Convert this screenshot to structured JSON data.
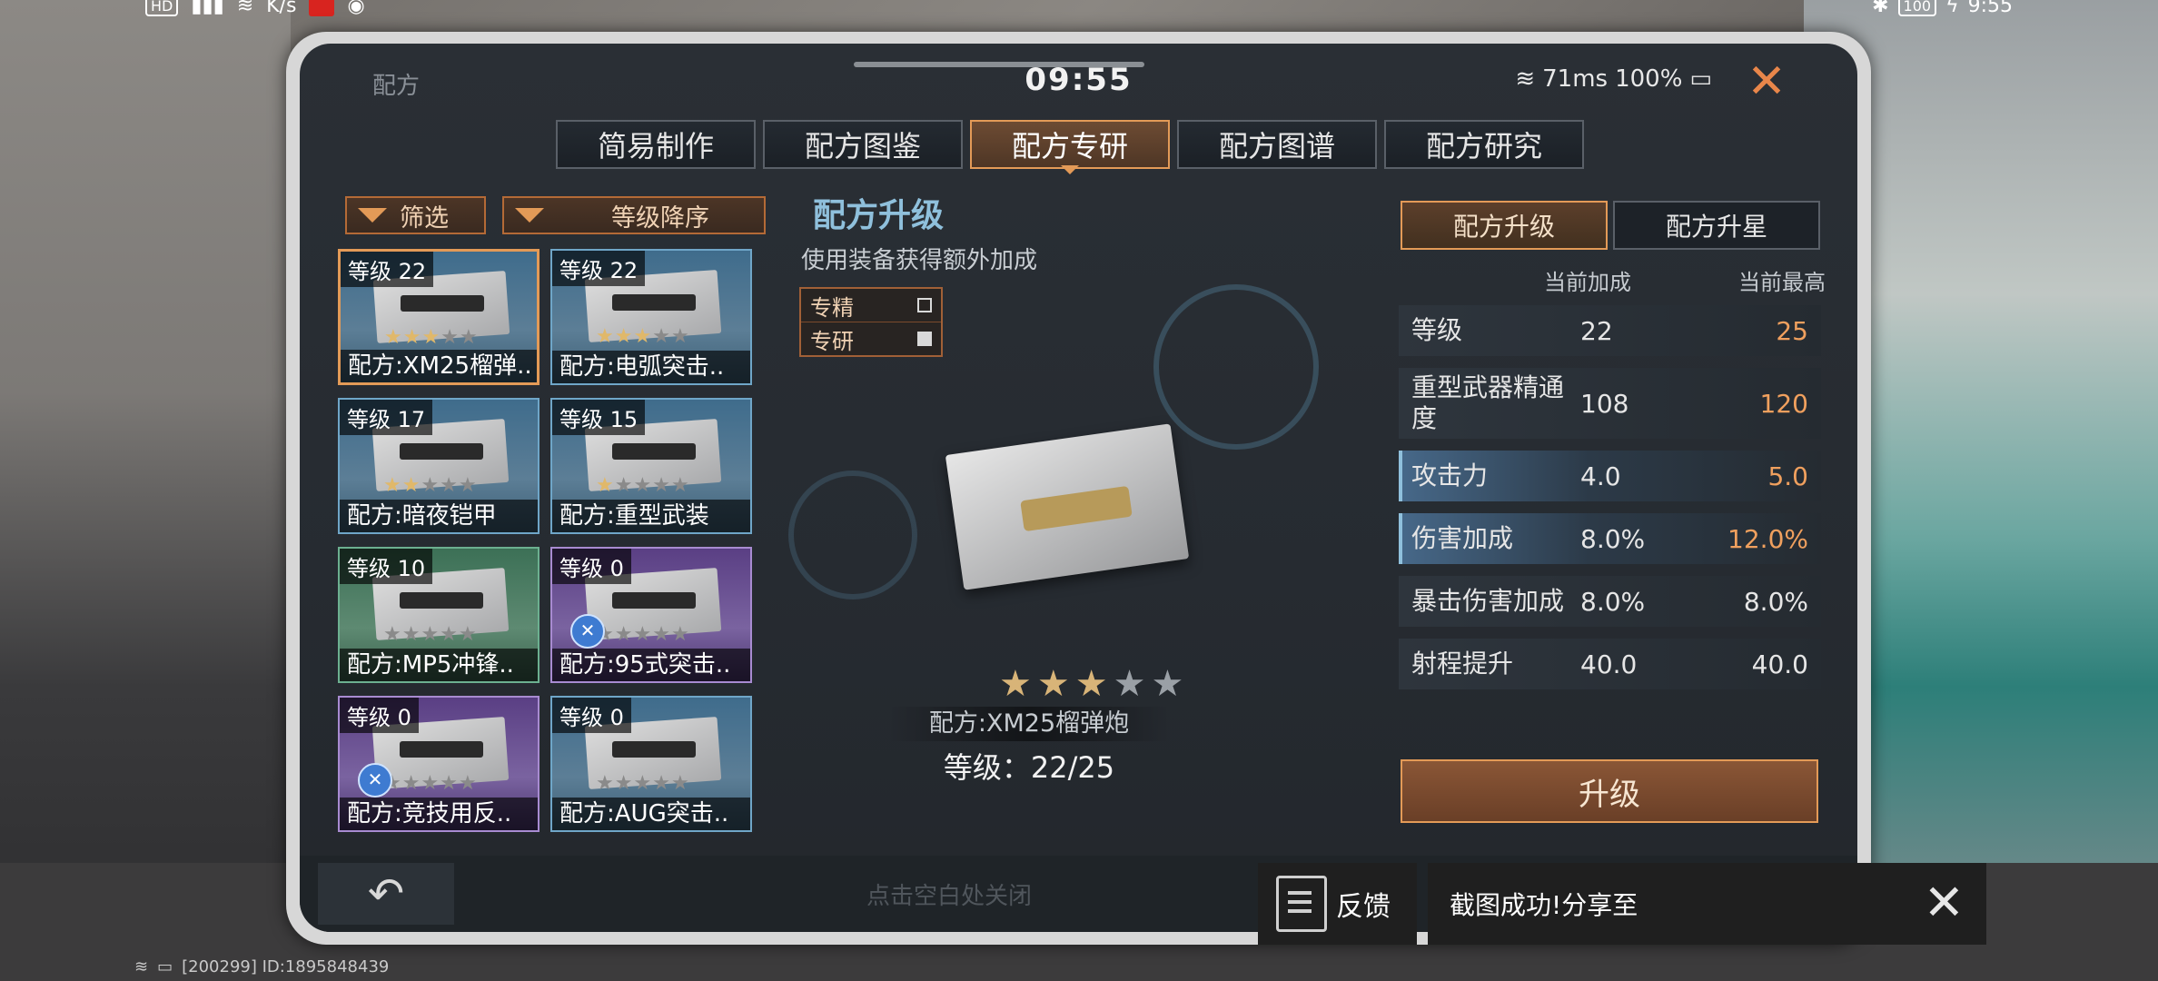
{
  "status_bar": {
    "hd": "HD",
    "speed": "K/s",
    "battery": "100",
    "time": "9:55"
  },
  "window": {
    "title": "配方",
    "clock": "09:55",
    "ping": "71ms",
    "battery": "100%"
  },
  "tabs": [
    {
      "label": "简易制作",
      "active": false
    },
    {
      "label": "配方图鉴",
      "active": false
    },
    {
      "label": "配方专研",
      "active": true
    },
    {
      "label": "配方图谱",
      "active": false
    },
    {
      "label": "配方研究",
      "active": false
    }
  ],
  "filters": {
    "filter_label": "筛选",
    "sort_label": "等级降序"
  },
  "cards": [
    {
      "level": "等级 22",
      "name": "配方:XM25榴弹..",
      "stars": 3,
      "theme": "blue",
      "selected": true,
      "badge": false
    },
    {
      "level": "等级 22",
      "name": "配方:电弧突击..",
      "stars": 3,
      "theme": "blue",
      "selected": false,
      "badge": false
    },
    {
      "level": "等级 17",
      "name": "配方:暗夜铠甲",
      "stars": 2,
      "theme": "blue",
      "selected": false,
      "badge": false
    },
    {
      "level": "等级 15",
      "name": "配方:重型武装",
      "stars": 1,
      "theme": "blue",
      "selected": false,
      "badge": false
    },
    {
      "level": "等级 10",
      "name": "配方:MP5冲锋..",
      "stars": 0,
      "theme": "green",
      "selected": false,
      "badge": false
    },
    {
      "level": "等级 0",
      "name": "配方:95式突击..",
      "stars": 0,
      "theme": "purple",
      "selected": false,
      "badge": true
    },
    {
      "level": "等级 0",
      "name": "配方:竞技用反..",
      "stars": 0,
      "theme": "purple",
      "selected": false,
      "badge": true
    },
    {
      "level": "等级 0",
      "name": "配方:AUG突击..",
      "stars": 0,
      "theme": "blue",
      "selected": false,
      "badge": false
    }
  ],
  "center": {
    "title": "配方升级",
    "subtitle": "使用装备获得额外加成",
    "modes": [
      {
        "label": "专精",
        "checked": false
      },
      {
        "label": "专研",
        "checked": true
      }
    ],
    "item_name": "配方:XM25榴弹炮",
    "item_level": "等级：22/25",
    "stars_filled": 3,
    "stars_total": 5
  },
  "right": {
    "tabs": [
      {
        "label": "配方升级",
        "active": true
      },
      {
        "label": "配方升星",
        "active": false
      }
    ],
    "col_current": "当前加成",
    "col_max": "当前最高",
    "stats": [
      {
        "label": "等级",
        "current": "22",
        "max": "25",
        "max_up": true,
        "highlight": false,
        "tall": false
      },
      {
        "label": "重型武器精通度",
        "current": "108",
        "max": "120",
        "max_up": true,
        "highlight": false,
        "tall": true
      },
      {
        "label": "攻击力",
        "current": "4.0",
        "max": "5.0",
        "max_up": true,
        "highlight": true,
        "tall": false
      },
      {
        "label": "伤害加成",
        "current": "8.0%",
        "max": "12.0%",
        "max_up": true,
        "highlight": true,
        "tall": false
      },
      {
        "label": "暴击伤害加成",
        "current": "8.0%",
        "max": "8.0%",
        "max_up": false,
        "highlight": false,
        "tall": false
      },
      {
        "label": "射程提升",
        "current": "40.0",
        "max": "40.0",
        "max_up": false,
        "highlight": false,
        "tall": false
      }
    ],
    "upgrade_label": "升级"
  },
  "bottom": {
    "close_hint": "点击空白处关闭",
    "player_id": "[200299] ID:1895848439"
  },
  "overlay": {
    "feedback_label": "反馈",
    "share_text": "截图成功!分享至"
  },
  "colors": {
    "accent_orange": "#e39a57",
    "title_blue": "#8fc0dc",
    "panel_bg": "#262b31"
  }
}
